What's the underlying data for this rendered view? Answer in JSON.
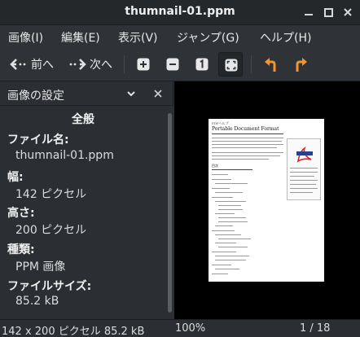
{
  "window": {
    "title": "thumnail-01.ppm"
  },
  "menubar": {
    "items": [
      "画像(I)",
      "編集(E)",
      "表示(V)",
      "ジャンプ(G)",
      "ヘルプ(H)"
    ]
  },
  "toolbar": {
    "prev_label": "前へ",
    "next_label": "次へ",
    "buttons": [
      "zoom-in-icon",
      "zoom-out-icon",
      "zoom-normal-icon",
      "zoom-fit-icon",
      "rotate-left-icon",
      "rotate-right-icon"
    ],
    "accent": "#f0962c"
  },
  "sidepane": {
    "title": "画像の設定",
    "section_title": "全般",
    "properties": [
      {
        "label": "ファイル名:",
        "value": "thumnail-01.ppm"
      },
      {
        "label": "幅:",
        "value": "142 ピクセル"
      },
      {
        "label": "高さ:",
        "value": "200 ピクセル"
      },
      {
        "label": "種類:",
        "value": "PPM 画像"
      },
      {
        "label": "ファイルサイズ:",
        "value": "85.2 kB"
      }
    ]
  },
  "viewer": {
    "background": "#000000",
    "page_header": "PDFヘルプ",
    "page_title": "Portable Document Format",
    "page_section": "目次"
  },
  "statusbar": {
    "info": "142 x 200 ピクセル  85.2 kB",
    "zoom": "100%",
    "pages": "1 / 18"
  }
}
